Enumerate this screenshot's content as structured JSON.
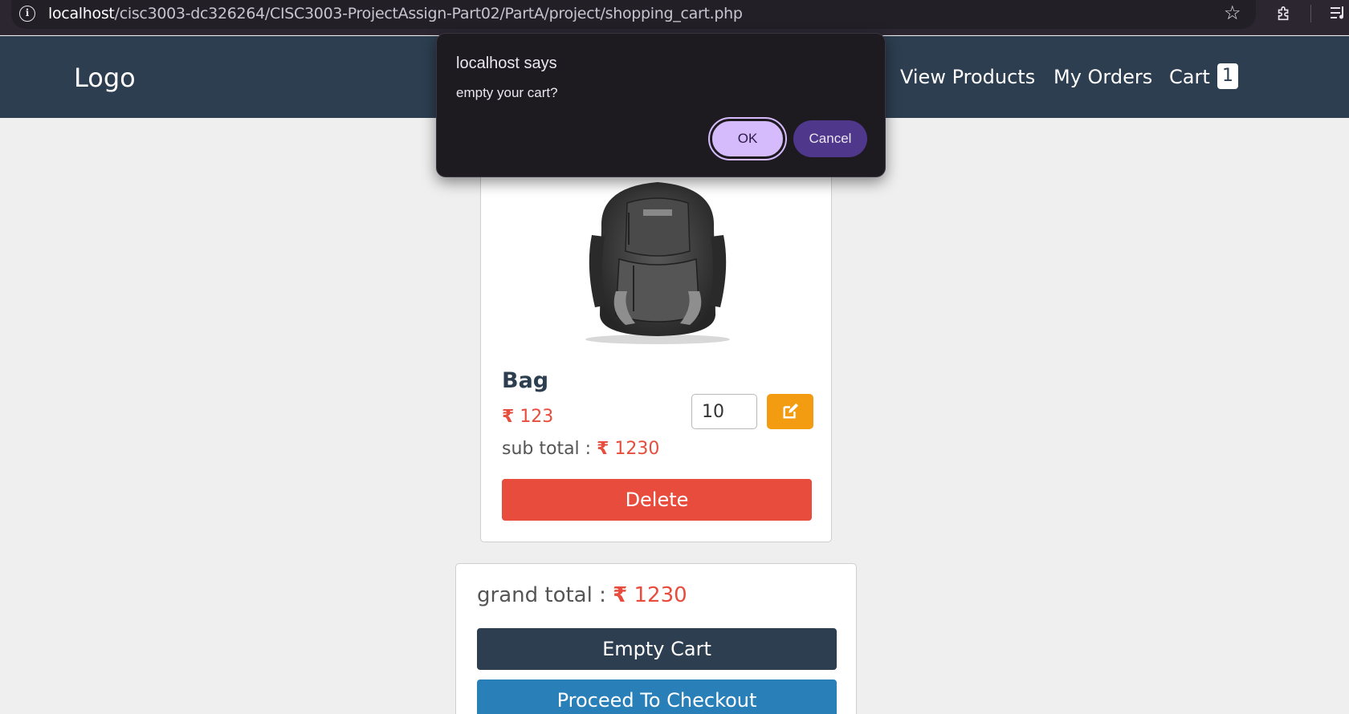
{
  "browser": {
    "url_host": "localhost",
    "url_path": "/cisc3003-dc326264/CISC3003-ProjectAssign-Part02/PartA/project/shopping_cart.php"
  },
  "header": {
    "logo": "Logo",
    "nav": {
      "view_products": "View Products",
      "my_orders": "My Orders",
      "cart": "Cart",
      "cart_count": "1"
    }
  },
  "product": {
    "name": "Bag",
    "currency_symbol": "₹",
    "price": "123",
    "quantity": "10",
    "subtotal_label": "sub total : ",
    "subtotal": "1230",
    "delete_label": "Delete"
  },
  "totals": {
    "grand_total_label": "grand total : ",
    "grand_total": "1230",
    "empty_cart_label": "Empty Cart",
    "checkout_label": "Proceed To Checkout"
  },
  "dialog": {
    "title": "localhost says",
    "message": "empty your cart?",
    "ok_label": "OK",
    "cancel_label": "Cancel"
  },
  "colors": {
    "header_bg": "#2c3e50",
    "accent_red": "#e74c3c",
    "edit_orange": "#f39c12",
    "checkout_blue": "#2980b9",
    "dialog_ok": "#d5bbfc",
    "dialog_cancel": "#4f378b"
  }
}
